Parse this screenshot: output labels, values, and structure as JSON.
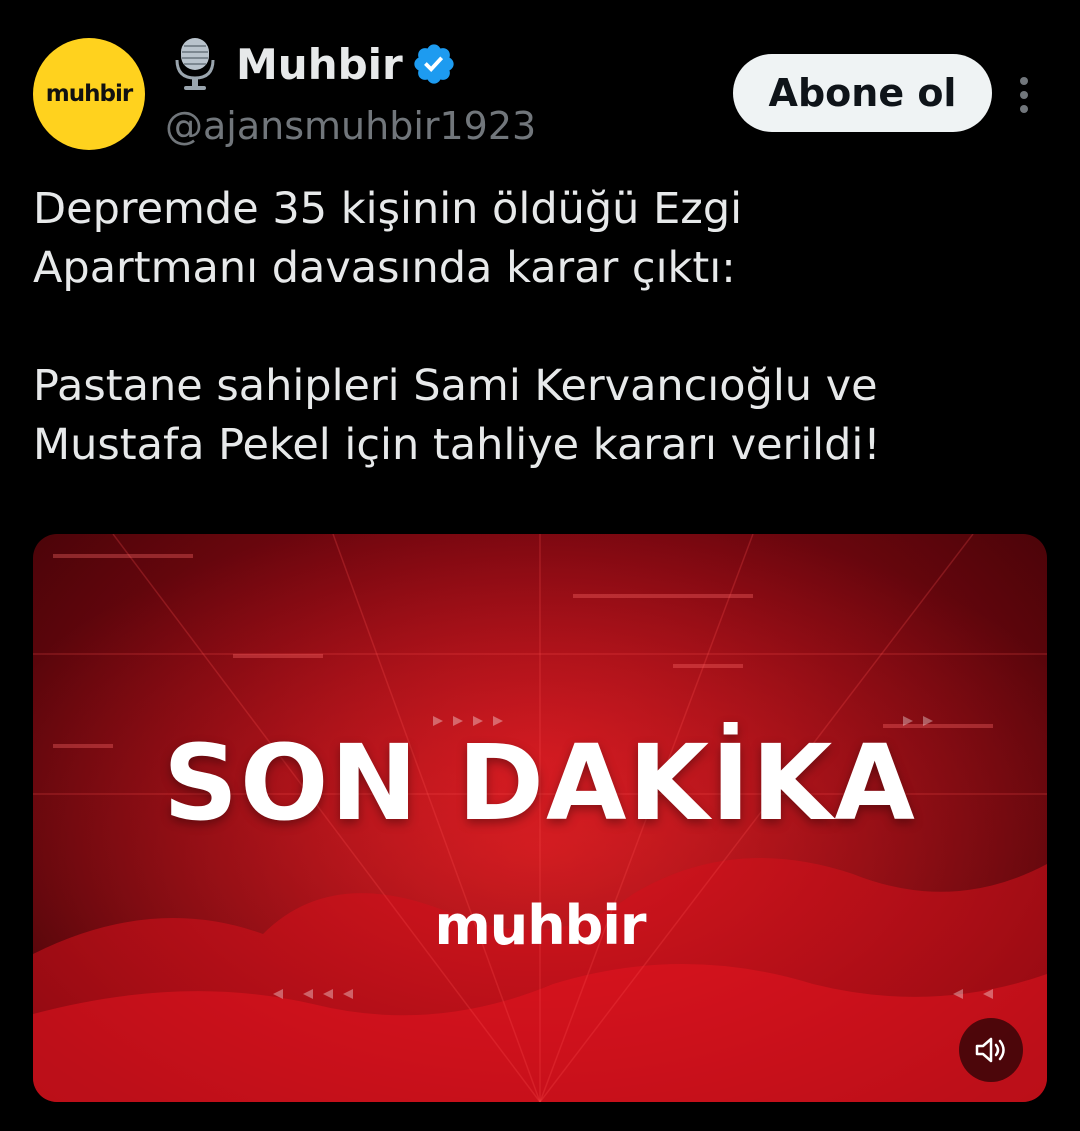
{
  "account": {
    "avatar_text": "muhbir",
    "display_name": "Muhbir",
    "handle": "@ajansmuhbir1923",
    "name_emoji_icon": "microphone-icon",
    "badge_icon": "verified-badge-icon"
  },
  "actions": {
    "follow_label": "Abone ol",
    "more_icon": "more-options-icon"
  },
  "tweet": {
    "paragraphs": [
      "Depremde 35 kişinin öldüğü Ezgi\nApartmanı davasında karar çıktı:",
      "Pastane sahipleri Sami Kervancıoğlu ve\nMustafa Pekel için tahliye kararı verildi!"
    ]
  },
  "media": {
    "headline": "SON DAKİKA",
    "brand": "muhbir",
    "sound_icon": "speaker-muted-icon"
  },
  "colors": {
    "background": "#000000",
    "avatar_bg": "#ffd21e",
    "verified": "#1d9bf0",
    "text_primary": "#e7e9ea",
    "text_secondary": "#71767b",
    "button_bg": "#eff3f4",
    "media_red": "#b3101b"
  }
}
